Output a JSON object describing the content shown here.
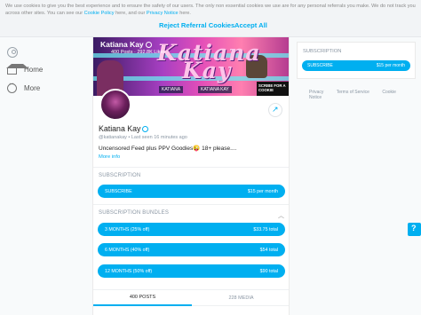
{
  "cookie_banner": {
    "text_1": "We use cookies to give you the best experience and to ensure the safety of our users. The only non essential cookies we use are for any personal referrals you make. We do not track you across other sites. You can see our ",
    "cookie_policy_link": "Cookie Policy",
    "text_2": " here, and our ",
    "privacy_notice_link": "Privacy Notice",
    "text_3": " here.",
    "reject_label": "Reject Referral Cookies",
    "accept_label": "Accept All"
  },
  "nav": {
    "home_label": "Home",
    "more_label": "More"
  },
  "cover": {
    "name": "Katiana Kay",
    "stats": "400 Posts · 292.8K Likes",
    "big_text_1": "Katiana",
    "big_text_2": "Kay",
    "tag_1": "KATIANA",
    "tag_2": "KATIANA KAY",
    "subscribe_card": "SCRIBE FOR A COOKIE"
  },
  "profile": {
    "name": "Katiana Kay",
    "handle": "@katianakay",
    "last_seen": "Last seen 16 minutes ago",
    "bio": "Uncensored Feed plus PPV Goodies😜 18+ please....",
    "more_info": "More info"
  },
  "subscription": {
    "title": "SUBSCRIPTION",
    "button_label": "SUBSCRIBE",
    "button_price": "$15 per month"
  },
  "bundles": {
    "title": "SUBSCRIPTION BUNDLES",
    "items": [
      {
        "label": "3 MONTHS (25% off)",
        "price": "$33.75 total"
      },
      {
        "label": "6 MONTHS (40% off)",
        "price": "$54 total"
      },
      {
        "label": "12 MONTHS (50% off)",
        "price": "$90 total"
      }
    ]
  },
  "tabs": {
    "posts": "400 POSTS",
    "media": "228 MEDIA"
  },
  "sidebar_card": {
    "title": "SUBSCRIPTION",
    "button_label": "SUBSCRIBE",
    "button_price": "$15 per month"
  },
  "footer": {
    "privacy": "Privacy",
    "terms": "Terms of Service",
    "cookie_notice": "Cookie Notice"
  },
  "colors": {
    "accent": "#00aff0"
  }
}
